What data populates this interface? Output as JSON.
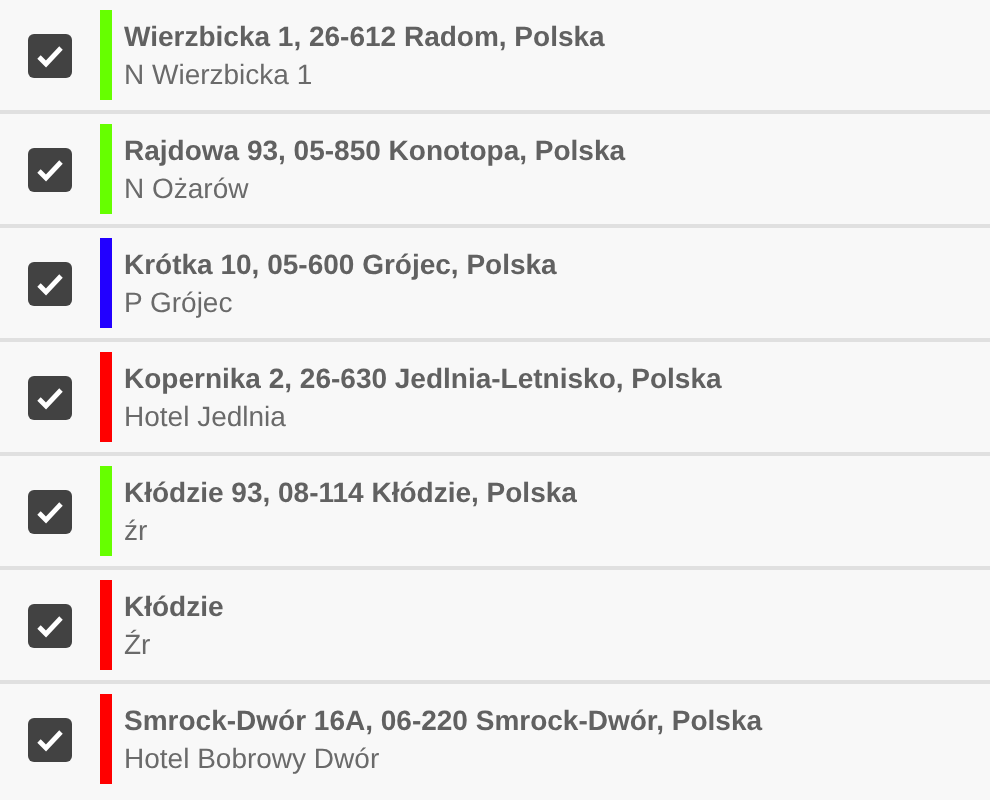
{
  "stops": [
    {
      "title": "Wierzbicka 1, 26-612 Radom, Polska",
      "subtitle": "N Wierzbicka 1",
      "checked": true,
      "color": "#66ff00"
    },
    {
      "title": "Rajdowa 93, 05-850 Konotopa, Polska",
      "subtitle": "N Ożarów",
      "checked": true,
      "color": "#66ff00"
    },
    {
      "title": "Krótka 10, 05-600 Grójec, Polska",
      "subtitle": "P Grójec",
      "checked": true,
      "color": "#2200ff"
    },
    {
      "title": "Kopernika 2, 26-630 Jedlnia-Letnisko, Polska",
      "subtitle": "Hotel Jedlnia",
      "checked": true,
      "color": "#ff0000"
    },
    {
      "title": "Kłódzie 93, 08-114 Kłódzie, Polska",
      "subtitle": "źr",
      "checked": true,
      "color": "#66ff00"
    },
    {
      "title": "Kłódzie",
      "subtitle": "Źr",
      "checked": true,
      "color": "#ff0000"
    },
    {
      "title": "Smrock-Dwór 16A, 06-220 Smrock-Dwór, Polska",
      "subtitle": "Hotel Bobrowy Dwór",
      "checked": true,
      "color": "#ff0000"
    }
  ]
}
